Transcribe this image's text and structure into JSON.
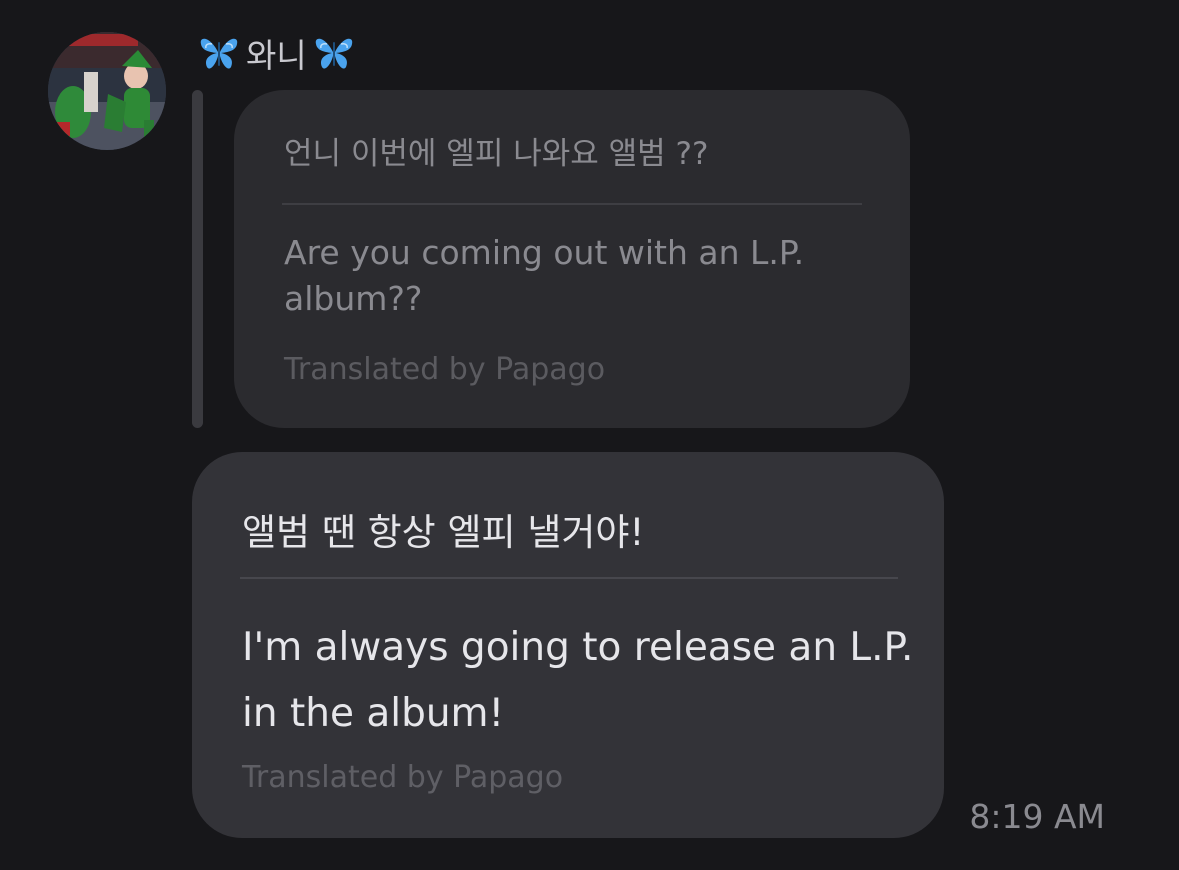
{
  "sender": {
    "name": "와니",
    "leading_icon": "butterfly-icon",
    "trailing_icon": "butterfly-icon",
    "icon_color": "#4aa3ee"
  },
  "quoted_message": {
    "original_text": "언니 이번에 엘피 나와요 앨범 ??",
    "translated_text": "Are you coming out with an L.P. album??",
    "translation_credit": "Translated by Papago"
  },
  "message": {
    "original_text": "앨범 땐 항상 엘피 낼거야!",
    "translated_text": "I'm always going to release an L.P. in the album!",
    "translation_credit": "Translated by Papago",
    "timestamp": "8:19 AM"
  },
  "colors": {
    "background": "#17171a",
    "quoted_bubble": "#2b2b2f",
    "message_bubble": "#333338"
  }
}
